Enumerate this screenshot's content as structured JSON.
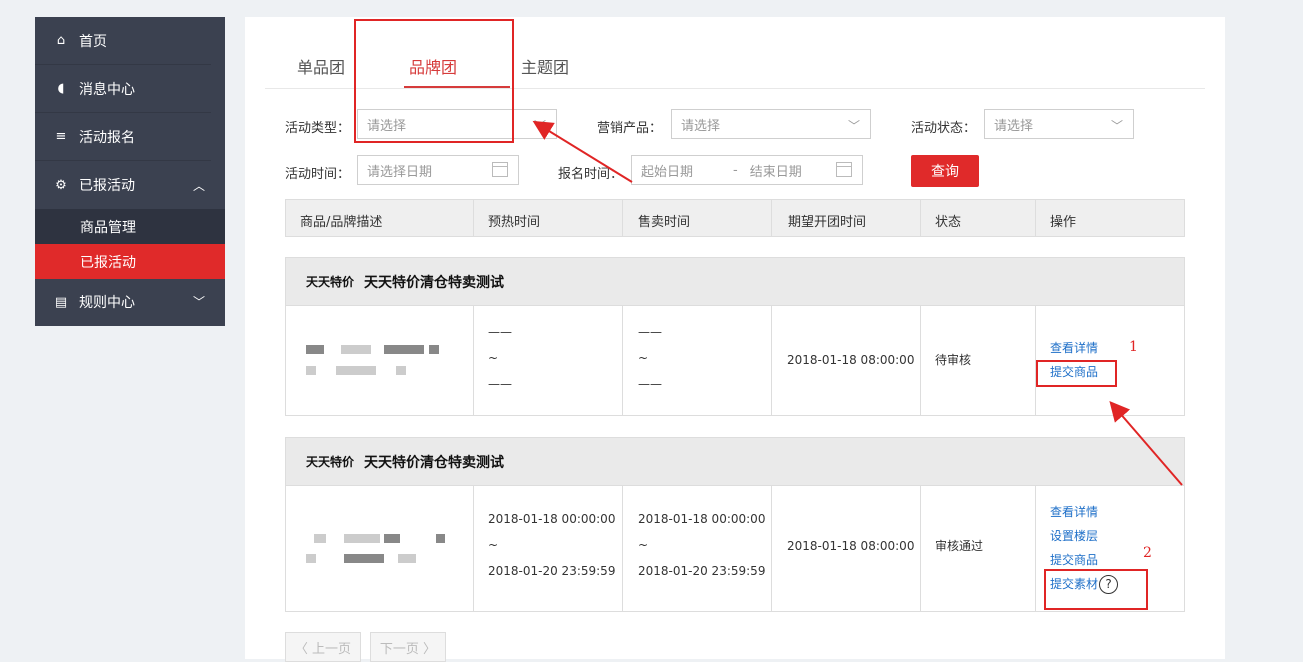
{
  "sidebar": {
    "items": [
      {
        "label": "首页",
        "icon": "home-icon"
      },
      {
        "label": "消息中心",
        "icon": "speaker-icon"
      },
      {
        "label": "活动报名",
        "icon": "edit-list-icon"
      },
      {
        "label": "已报活动",
        "icon": "gear-icon"
      }
    ],
    "subitems": [
      "商品管理",
      "已报活动"
    ],
    "rules": {
      "label": "规则中心",
      "icon": "document-icon"
    }
  },
  "tabs": [
    "单品团",
    "品牌团",
    "主题团"
  ],
  "filters": {
    "activity_type_label": "活动类型：",
    "activity_type_placeholder": "请选择",
    "product_label": "营销产品：",
    "product_placeholder": "请选择",
    "status_label": "活动状态：",
    "status_placeholder": "请选择",
    "activity_time_label": "活动时间：",
    "activity_time_placeholder": "请选择日期",
    "signup_time_label": "报名时间：",
    "start_placeholder": "起始日期",
    "range_sep": "-",
    "end_placeholder": "结束日期",
    "query_label": "查询"
  },
  "table": {
    "columns": [
      "商品/品牌描述",
      "预热时间",
      "售卖时间",
      "期望开团时间",
      "状态",
      "操作"
    ],
    "groups": [
      {
        "tag": "天天特价",
        "title": "天天特价清仓特卖测试",
        "preheat": [
          "——",
          "~",
          "——"
        ],
        "sale": [
          "——",
          "~",
          "——"
        ],
        "expected": "2018-01-18 08:00:00",
        "status": "待审核",
        "actions": [
          "查看详情",
          "提交商品"
        ]
      },
      {
        "tag": "天天特价",
        "title": "天天特价清仓特卖测试",
        "preheat": [
          "2018-01-18 00:00:00",
          "~",
          "2018-01-20 23:59:59"
        ],
        "sale": [
          "2018-01-18 00:00:00",
          "~",
          "2018-01-20 23:59:59"
        ],
        "expected": "2018-01-18 08:00:00",
        "status": "审核通过",
        "actions": [
          "查看详情",
          "设置楼层",
          "提交商品",
          "提交素材"
        ]
      }
    ]
  },
  "help_symbol": "?",
  "pager": {
    "prev": "〈 上一页",
    "next": "下一页 〉"
  },
  "annotations": {
    "mark1": "1",
    "mark2": "2",
    "color": "#e02525"
  }
}
